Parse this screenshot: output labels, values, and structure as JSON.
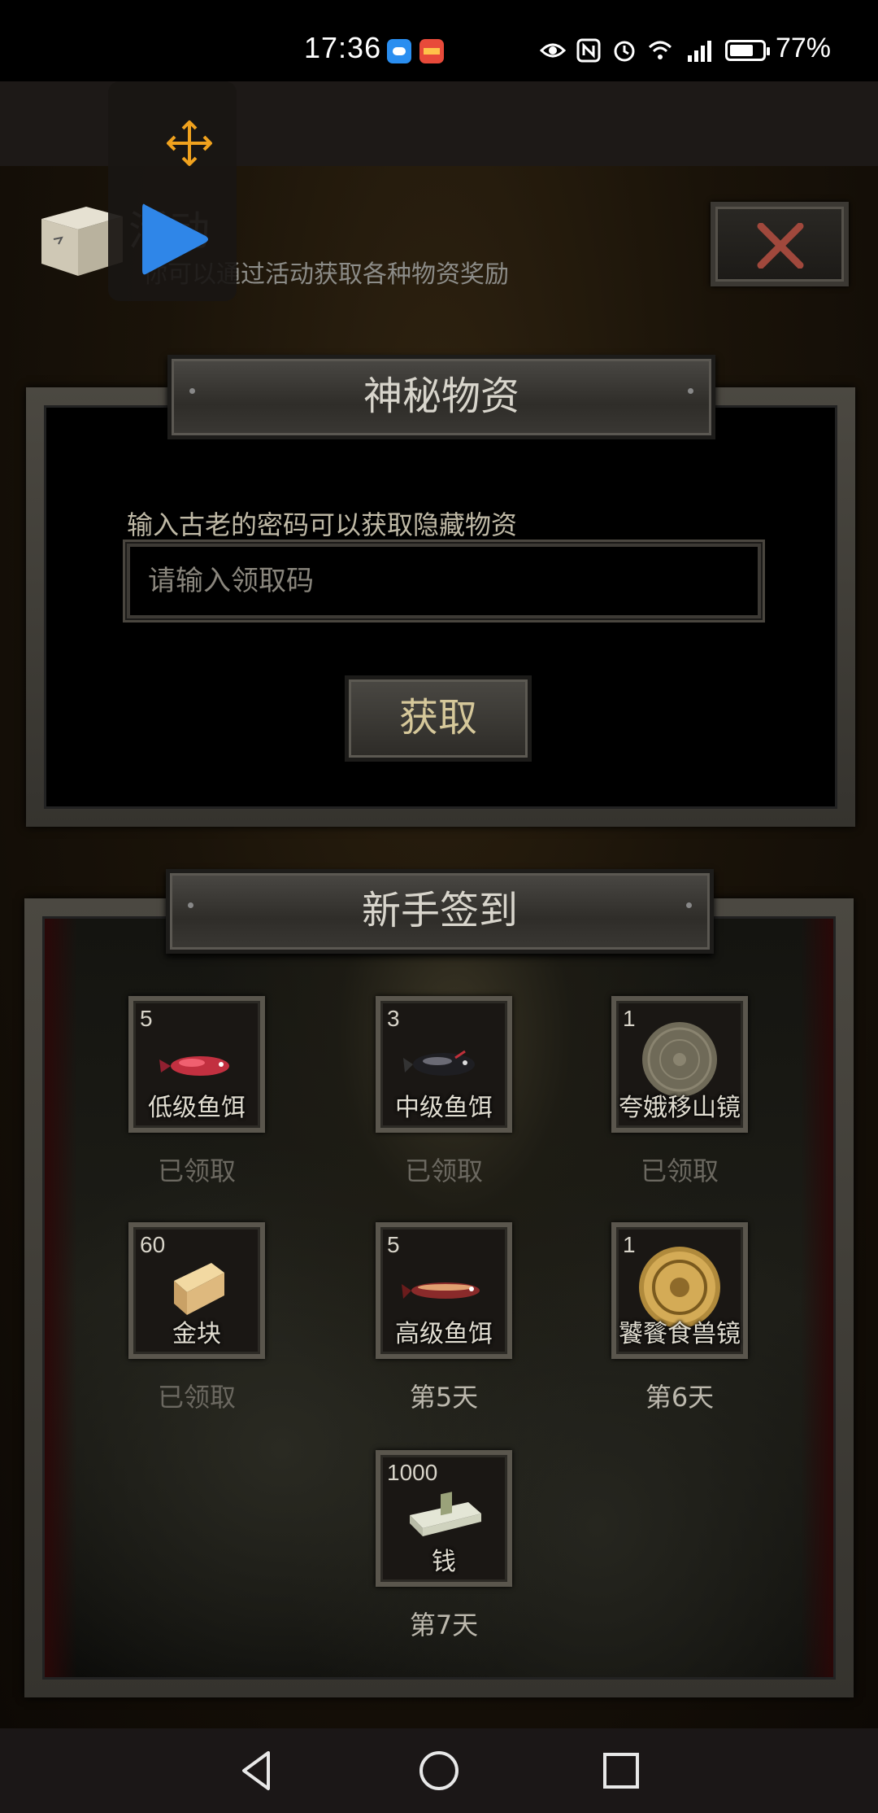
{
  "status_bar": {
    "time": "17:36",
    "battery_pct": "77%",
    "icons": [
      "eye-icon",
      "nfc-icon",
      "alarm-icon",
      "wifi-icon",
      "signal-4g-icon",
      "battery-icon"
    ]
  },
  "header": {
    "title": "活动",
    "subtitle": "你可以通过活动获取各种物资奖励",
    "close_icon": "close-icon"
  },
  "mystery_panel": {
    "title": "神秘物资",
    "hint": "输入古老的密码可以获取隐藏物资",
    "input_placeholder": "请输入领取码",
    "input_value": "",
    "submit_label": "获取"
  },
  "signin_panel": {
    "title": "新手签到",
    "rewards": [
      {
        "qty": "5",
        "name": "低级鱼饵",
        "status": "已领取",
        "claimed": true,
        "icon": "lure-red-icon"
      },
      {
        "qty": "3",
        "name": "中级鱼饵",
        "status": "已领取",
        "claimed": true,
        "icon": "lure-black-icon"
      },
      {
        "qty": "1",
        "name": "夸娥移山镜",
        "status": "已领取",
        "claimed": true,
        "icon": "bronze-mirror-icon"
      },
      {
        "qty": "60",
        "name": "金块",
        "status": "已领取",
        "claimed": true,
        "icon": "gold-bar-icon"
      },
      {
        "qty": "5",
        "name": "高级鱼饵",
        "status": "第5天",
        "claimed": false,
        "icon": "lure-gold-icon"
      },
      {
        "qty": "1",
        "name": "饕餮食兽镜",
        "status": "第6天",
        "claimed": false,
        "icon": "golden-mirror-icon"
      },
      {
        "qty": "1000",
        "name": "钱",
        "status": "第7天",
        "claimed": false,
        "icon": "cash-stack-icon"
      }
    ]
  },
  "colors": {
    "claimed_text": "#6b6860",
    "pending_text": "#bcb8ad",
    "button_text": "#d6c89a",
    "close_x": "#a0483c",
    "play_blue": "#2f86e8",
    "move_orange": "#f0a21e"
  }
}
